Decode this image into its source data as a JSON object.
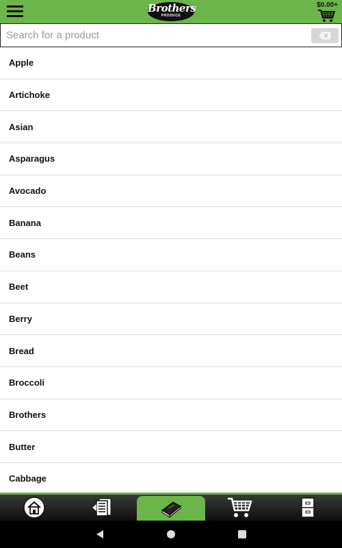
{
  "header": {
    "menu_icon": "hamburger-menu-icon",
    "logo_text": "Brothers",
    "logo_subtext": "PRODUCE",
    "cart_total": "$0.00+",
    "cart_icon": "shopping-cart-icon",
    "accent_color": "#6bb54a"
  },
  "search": {
    "placeholder": "Search for a product",
    "value": "",
    "clear_icon": "backspace-icon"
  },
  "products": [
    "Apple",
    "Artichoke",
    "Asian",
    "Asparagus",
    "Avocado",
    "Banana",
    "Beans",
    "Beet",
    "Berry",
    "Bread",
    "Broccoli",
    "Brothers",
    "Butter",
    "Cabbage"
  ],
  "bottom_nav": {
    "tabs": [
      {
        "icon": "home-icon",
        "active": false
      },
      {
        "icon": "order-list-icon",
        "active": false
      },
      {
        "icon": "catalog-book-icon",
        "active": true
      },
      {
        "icon": "shopping-cart-icon",
        "active": false
      },
      {
        "icon": "file-cabinet-icon",
        "active": false
      }
    ]
  },
  "system_nav": {
    "buttons": [
      "back-icon",
      "home-circle-icon",
      "recents-square-icon"
    ]
  }
}
